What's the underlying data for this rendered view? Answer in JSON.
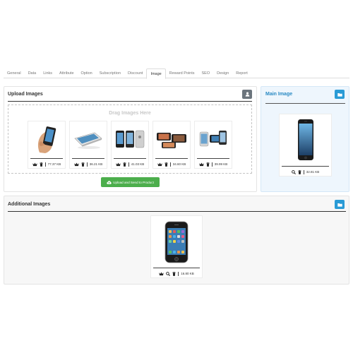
{
  "tabs": [
    "General",
    "Data",
    "Links",
    "Attribute",
    "Option",
    "Subscription",
    "Discount",
    "Image",
    "Reward Points",
    "SEO",
    "Design",
    "Report"
  ],
  "active_tab": "Image",
  "upload_panel": {
    "title": "Upload Images",
    "drop_text": "Drag Images Here",
    "upload_button_label": "Upload and Send to Product",
    "thumbnails": [
      {
        "size": "77.37 KB",
        "image": "hand-holding-phone"
      },
      {
        "size": "36.21 KB",
        "image": "phone-lying-flat"
      },
      {
        "size": "41.03 KB",
        "image": "phones-front-back"
      },
      {
        "size": "34.60 KB",
        "image": "phones-landscape"
      },
      {
        "size": "39.99 KB",
        "image": "phones-trio"
      }
    ]
  },
  "main_image": {
    "title": "Main Image",
    "size": "32.81 KB"
  },
  "additional_images": {
    "title": "Additional Images",
    "items": [
      {
        "size": "16.80 KB"
      }
    ]
  },
  "colors": {
    "accent_blue": "#2a9bd6",
    "upload_green": "#4cae4c",
    "main_panel_bg": "#eef6fd"
  }
}
